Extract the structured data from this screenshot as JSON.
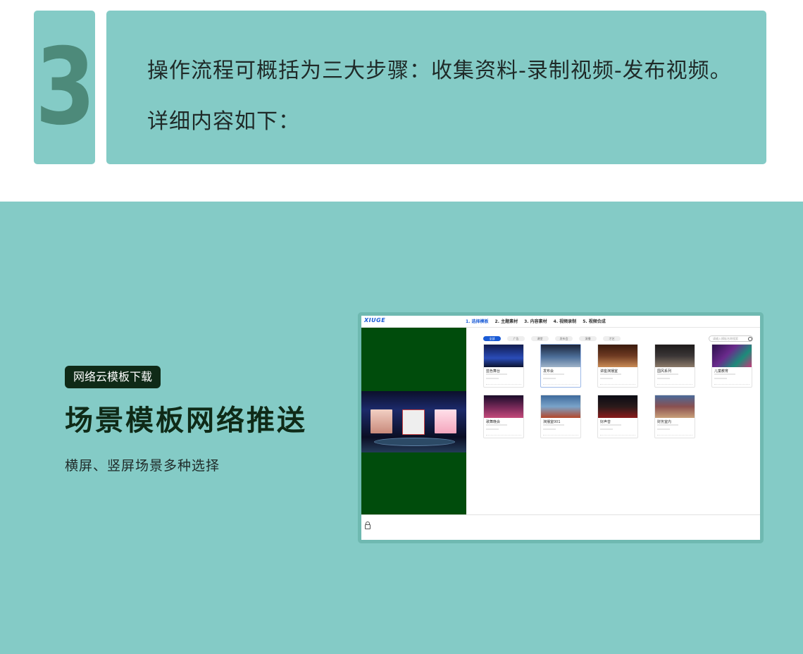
{
  "step": {
    "number": "3"
  },
  "intro": {
    "line1": "操作流程可概括为三大步骤：收集资料-录制视频-发布视频。",
    "line2": "详细内容如下："
  },
  "feature": {
    "tag": "网络云模板下载",
    "title": "场景模板网络推送",
    "description": "横屏、竖屏场景多种选择"
  },
  "app": {
    "logo": "XIUGE",
    "steps": [
      {
        "label": "1. 选择模板",
        "active": true
      },
      {
        "label": "2. 主题素材",
        "active": false
      },
      {
        "label": "3. 内容素材",
        "active": false
      },
      {
        "label": "4. 视频录制",
        "active": false
      },
      {
        "label": "5. 视频合成",
        "active": false
      }
    ],
    "filters": [
      "全部",
      "广告",
      "课堂",
      "发布会",
      "演播",
      "才艺"
    ],
    "search_placeholder": "请输入模板名称搜索",
    "templates": [
      {
        "name": "蓝色舞台",
        "thumb_color": "#2a4cb8"
      },
      {
        "name": "发布会",
        "thumb_color": "#4d6f9a"
      },
      {
        "name": "讲座演播室",
        "thumb_color": "#6e3a22"
      },
      {
        "name": "国风系列",
        "thumb_color": "#3a3636"
      },
      {
        "name": "儿童教育",
        "thumb_color": "#6a2a8c"
      },
      {
        "name": "歌舞晚会",
        "thumb_color": "#7a2a5a"
      },
      {
        "name": "演播室001",
        "thumb_color": "#3e6a9c"
      },
      {
        "name": "好声音",
        "thumb_color": "#2a1a1a"
      },
      {
        "name": "财务室内",
        "thumb_color": "#8a5050"
      }
    ]
  },
  "colors": {
    "teal": "#84cbc6",
    "dark_green": "#0f2a17",
    "accent_blue": "#1a5bd6",
    "preview_green": "#004c0c"
  }
}
